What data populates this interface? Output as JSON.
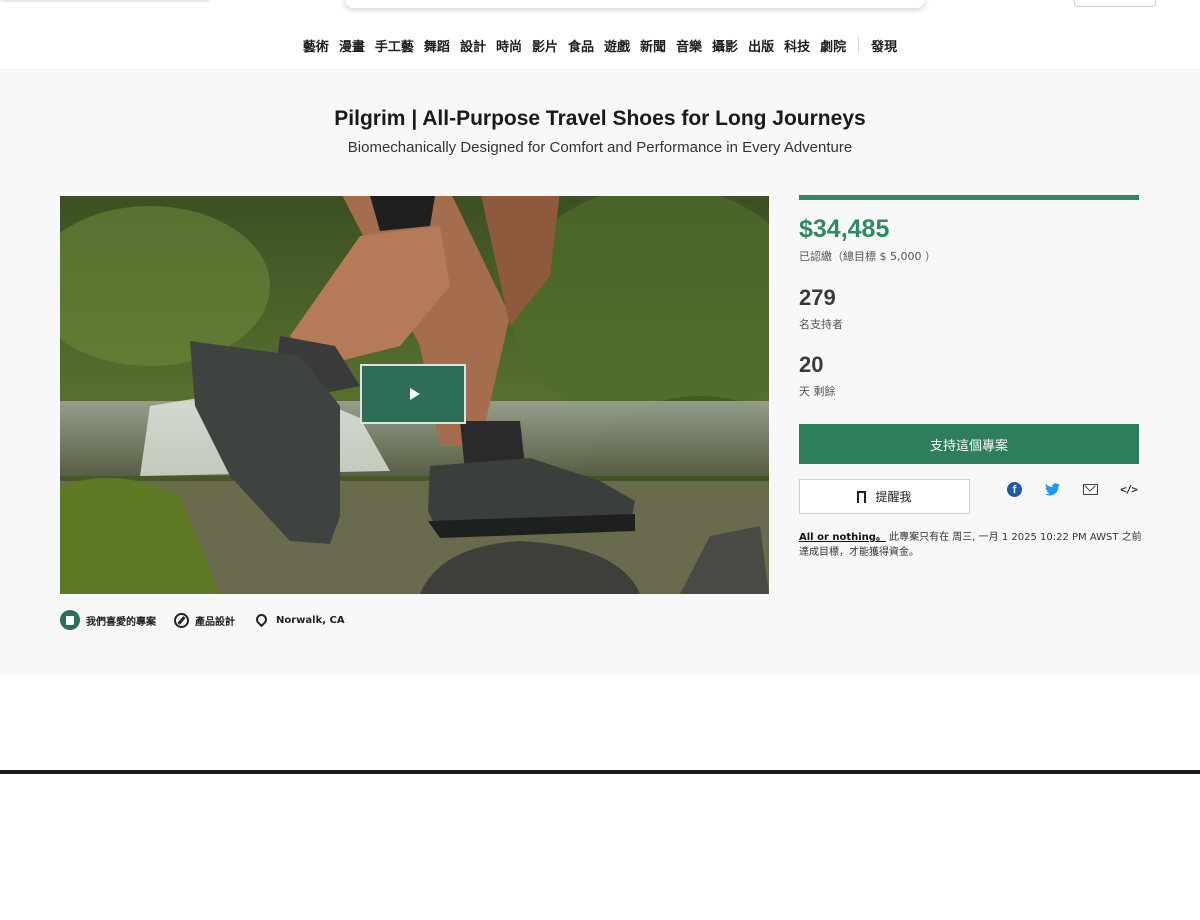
{
  "nav": {
    "categories": [
      "藝術",
      "漫畫",
      "手工藝",
      "舞蹈",
      "設計",
      "時尚",
      "影片",
      "食品",
      "遊戲",
      "新聞",
      "音樂",
      "攝影",
      "出版",
      "科技",
      "劇院"
    ],
    "discover": "發現"
  },
  "project": {
    "title": "Pilgrim | All-Purpose Travel Shoes for Long Journeys",
    "subtitle": "Biomechanically Designed for Comfort and Performance in Every Adventure",
    "meta": {
      "badge": "我們喜愛的專案",
      "category": "產品設計",
      "location": "Norwalk, CA"
    }
  },
  "funding": {
    "progress_fraction": 1.0,
    "pledged": "$34,485",
    "pledged_note": "已認繳（總目標 $ 5,000 ）",
    "backers": "279",
    "backers_label": "名支持者",
    "days": "20",
    "days_label": "天 剩餘",
    "back_button": "支持這個專案",
    "remind_button": "提醒我",
    "aon_link": "All or nothing。",
    "aon_text": " 此專案只有在 周三, 一月 1 2025 10:22 PM AWST 之前達成目標，才能獲得資金。"
  },
  "share": {
    "icons": [
      "facebook-icon",
      "twitter-icon",
      "email-icon",
      "embed-icon"
    ]
  },
  "colors": {
    "accent": "#2e8a5f",
    "button": "#2e7d5b",
    "play": "#2e6e57",
    "hero_bg": "#f8f8f8"
  }
}
